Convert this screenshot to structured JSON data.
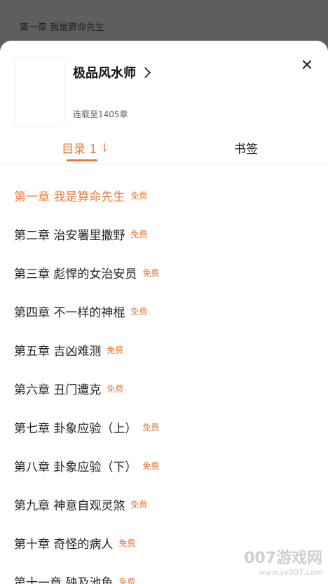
{
  "background": {
    "chapter_title": "第一章 我是算命先生"
  },
  "book": {
    "title": "极品风水师",
    "status": "连载至1405章"
  },
  "tabs": {
    "toc": "目录 1",
    "toc_sort_icon": "sort-icon",
    "bookmarks": "书签"
  },
  "colors": {
    "accent": "#e87a3a",
    "overlay": "#5e5e5e"
  },
  "chapters": [
    {
      "title": "第一章 我是算命先生",
      "tag": "免费",
      "active": true
    },
    {
      "title": "第二章 治安署里撒野",
      "tag": "免费"
    },
    {
      "title": "第三章 彪悍的女治安员",
      "tag": "免费"
    },
    {
      "title": "第四章 不一样的神棍",
      "tag": "免费"
    },
    {
      "title": "第五章 吉凶难测",
      "tag": "免费"
    },
    {
      "title": "第六章 丑门遭克",
      "tag": "免费"
    },
    {
      "title": "第七章 卦象应验（上）",
      "tag": "免费"
    },
    {
      "title": "第八章 卦象应验（下）",
      "tag": "免费"
    },
    {
      "title": "第九章 神意自观灵煞",
      "tag": "免费"
    },
    {
      "title": "第十章 奇怪的病人",
      "tag": "免费"
    },
    {
      "title": "第十一章 殃及池鱼",
      "tag": "免费"
    }
  ],
  "watermark": {
    "brand": "007游戏网",
    "url": "www.yx007.com"
  }
}
